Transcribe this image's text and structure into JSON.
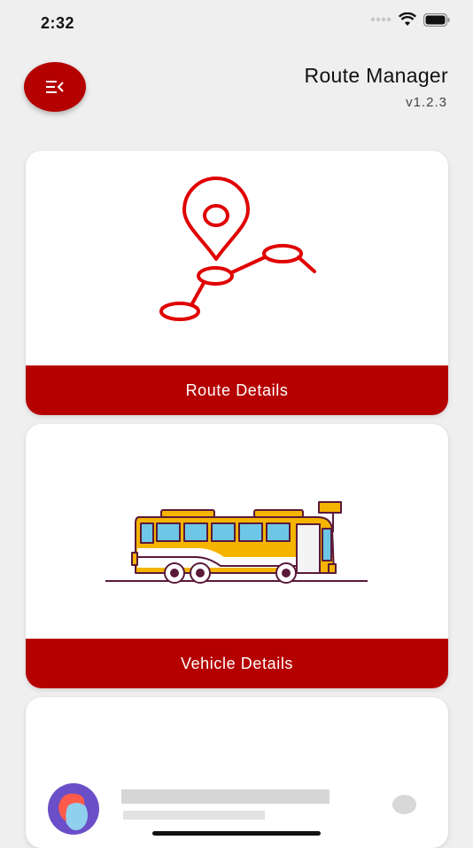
{
  "status_bar": {
    "time": "2:32"
  },
  "header": {
    "title": "Route Manager",
    "version": "v1.2.3"
  },
  "cards": [
    {
      "label": "Route Details",
      "icon": "route-map-icon"
    },
    {
      "label": "Vehicle Details",
      "icon": "bus-icon"
    }
  ],
  "colors": {
    "accent": "#b50000",
    "background": "#efefef"
  }
}
